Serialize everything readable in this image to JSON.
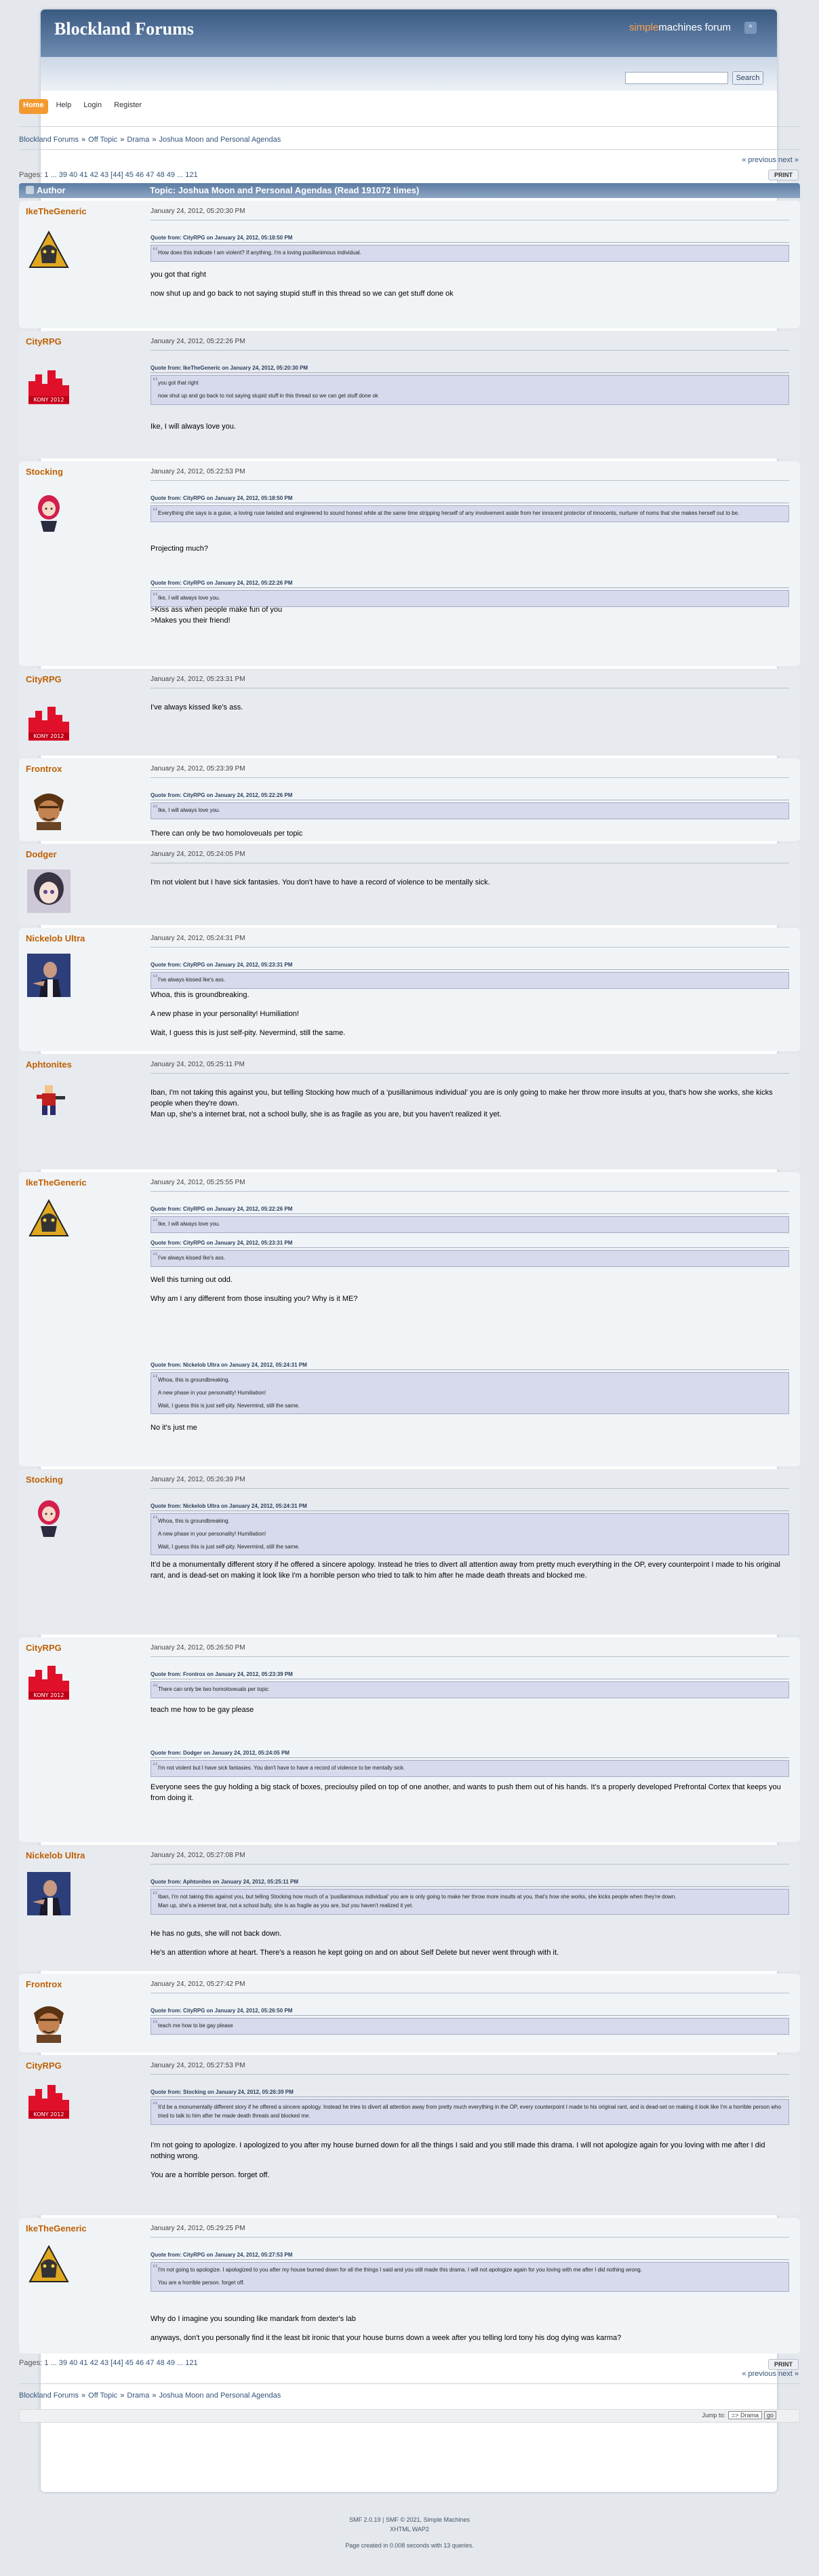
{
  "header": {
    "forum_name": "Blockland Forums",
    "smf_simple": "simple",
    "smf_rest": "machines forum",
    "upshrink": "^"
  },
  "search": {
    "button": "Search"
  },
  "menu": [
    {
      "label": "Home"
    },
    {
      "label": "Help"
    },
    {
      "label": "Login"
    },
    {
      "label": "Register"
    }
  ],
  "breadcrumb": [
    "Blockland Forums",
    "Off Topic",
    "Drama",
    "Joshua Moon and Personal Agendas"
  ],
  "crumb_sep": "»",
  "nav": {
    "prev": "« previous",
    "next": "next »",
    "print": "PRINT",
    "pages_label": "Pages:",
    "pages": "1 ... 39 40 41 42 43 [44] 45 46 47 48 49 ... 121"
  },
  "table_header": {
    "author": "Author",
    "topic": "Topic: Joshua Moon and Personal Agendas  (Read 191072 times)"
  },
  "posts": [
    {
      "user": "IkeTheGeneric",
      "date": "January 24, 2012, 05:20:30 PM",
      "quotes": [
        {
          "h": "Quote from: CityRPG on January 24, 2012, 05:18:50 PM",
          "b": "How does this indicate I am violent? If anything, I'm a loving pusillanimous individual."
        }
      ],
      "text": [
        "you got that right",
        "now shut up and go back to not saying stupid stuff in this thread so we can get stuff done ok"
      ]
    },
    {
      "user": "CityRPG",
      "date": "January 24, 2012, 05:22:26 PM",
      "quotes": [
        {
          "h": "Quote from: IkeTheGeneric on January 24, 2012, 05:20:30 PM",
          "b": "you got that right\n\nnow shut up and go back to not saying stupid stuff in this thread so we can get stuff done ok"
        }
      ],
      "text": [
        "Ike, I will always love you."
      ]
    },
    {
      "user": "Stocking",
      "date": "January 24, 2012, 05:22:53 PM",
      "quotes": [
        {
          "h": "Quote from: CityRPG on January 24, 2012, 05:18:50 PM",
          "b": "Everything she says is a guise, a loving ruse twisted and engineered to sound honest while at the same time stripping herself of any involvement aside from her innocent protector of innocents, nurturer of noms that she makes herself out to be."
        }
      ],
      "text": [
        "Projecting much?"
      ],
      "quotes2": [
        {
          "h": "Quote from: CityRPG on January 24, 2012, 05:22:26 PM",
          "b": "Ike, I will always love you."
        }
      ],
      "text2": [
        ">Kiss ass when people make fun of you\n>Makes you their friend!"
      ]
    },
    {
      "user": "CityRPG",
      "date": "January 24, 2012, 05:23:31 PM",
      "text": [
        "I've always kissed Ike's ass."
      ]
    },
    {
      "user": "Frontrox",
      "date": "January 24, 2012, 05:23:39 PM",
      "quotes": [
        {
          "h": "Quote from: CityRPG on January 24, 2012, 05:22:26 PM",
          "b": "Ike, I will always love you."
        }
      ],
      "text": [
        "There can only be two homoloveuals per topic"
      ]
    },
    {
      "user": "Dodger",
      "date": "January 24, 2012, 05:24:05 PM",
      "text": [
        "I'm not violent but I have sick fantasies. You don't have to have a record of violence to be mentally sick."
      ]
    },
    {
      "user": "Nickelob Ultra",
      "date": "January 24, 2012, 05:24:31 PM",
      "quotes": [
        {
          "h": "Quote from: CityRPG on January 24, 2012, 05:23:31 PM",
          "b": "I've always kissed Ike's ass."
        }
      ],
      "text": [
        "Whoa, this is groundbreaking.",
        "A new phase in your personality!  Humiliation!",
        "Wait, I guess this is just self-pity.  Nevermind, still the same."
      ]
    },
    {
      "user": "Aphtonites",
      "date": "January 24, 2012, 05:25:11 PM",
      "text": [
        "Iban, I'm not taking this against you, but telling Stocking how much of a 'pusillanimous individual' you are is only going to make her throw more insults at you, that's how she works, she kicks people when they're down.\nMan up, she's a internet brat, not a school bully, she is as fragile as you are, but you haven't realized it yet."
      ]
    },
    {
      "user": "IkeTheGeneric",
      "date": "January 24, 2012, 05:25:55 PM",
      "quotes": [
        {
          "h": "Quote from: CityRPG on January 24, 2012, 05:22:26 PM",
          "b": "Ike, I will always love you."
        },
        {
          "h": "Quote from: CityRPG on January 24, 2012, 05:23:31 PM",
          "b": "I've always kissed Ike's ass."
        }
      ],
      "text": [
        "Well this turning out odd.",
        "Why am I any different from those insulting you? Why is it ME?"
      ],
      "quotes2": [
        {
          "h": "Quote from: Nickelob Ultra on January 24, 2012, 05:24:31 PM",
          "b": "Whoa, this is groundbreaking.\n\nA new phase in your personality!  Humiliation!\n\nWait, I guess this is just self-pity.  Nevermind, still the same."
        }
      ],
      "text2": [
        "No it's just me"
      ]
    },
    {
      "user": "Stocking",
      "date": "January 24, 2012, 05:26:39 PM",
      "quotes": [
        {
          "h": "Quote from: Nickelob Ultra on January 24, 2012, 05:24:31 PM",
          "b": "Whoa, this is groundbreaking.\n\nA new phase in your personality!  Humiliation!\n\nWait, I guess this is just self-pity.  Nevermind, still the same."
        }
      ],
      "text": [
        "It'd be a monumentally different story if he offered a sincere apology. Instead he tries to divert all attention away from pretty much everything in the OP, every counterpoint I made to his original rant, and is dead-set on making it look like I'm a horrible person who tried to talk to him after he made death threats and blocked me."
      ]
    },
    {
      "user": "CityRPG",
      "date": "January 24, 2012, 05:26:50 PM",
      "quotes": [
        {
          "h": "Quote from: Frontrox on January 24, 2012, 05:23:39 PM",
          "b": "There can only be two homoloveuals per topic"
        }
      ],
      "text": [
        "teach me how to be gay please"
      ],
      "quotes2": [
        {
          "h": "Quote from: Dodger on January 24, 2012, 05:24:05 PM",
          "b": "I'm not violent but I have sick fantasies. You don't have to have a record of violence to be mentally sick."
        }
      ],
      "text2": [
        "Everyone sees the guy holding a big stack of boxes, precioulsy piled on top of one another, and wants to push them out of his hands. It's a properly developed Prefrontal Cortex that keeps you from doing it."
      ]
    },
    {
      "user": "Nickelob Ultra",
      "date": "January 24, 2012, 05:27:08 PM",
      "quotes": [
        {
          "h": "Quote from: Aphtonites on January 24, 2012, 05:25:11 PM",
          "b": "Iban, I'm not taking this against you, but telling Stocking how much of a 'pusillanimous individual' you are is only going to make her throw more insults at you, that's how she works, she kicks people when they're down.\nMan up, she's a internet brat, not a school bully, she is as fragile as you are, but you haven't realized it yet."
        }
      ],
      "text": [
        "He has no guts, she will not back down.",
        "He's an attention whore at heart.  There's a reason he kept going on and on about Self Delete but never went through with it."
      ]
    },
    {
      "user": "Frontrox",
      "date": "January 24, 2012, 05:27:42 PM",
      "quotes": [
        {
          "h": "Quote from: CityRPG on January 24, 2012, 05:26:50 PM",
          "b": "teach me how to be gay please"
        }
      ],
      "text": []
    },
    {
      "user": "CityRPG",
      "date": "January 24, 2012, 05:27:53 PM",
      "quotes": [
        {
          "h": "Quote from: Stocking on January 24, 2012, 05:26:39 PM",
          "b": "It'd be a monumentally different story if he offered a sincere apology. Instead he tries to divert all attention away from pretty much everything in the OP, every counterpoint I made to his original rant, and is dead-set on making it look like I'm a horrible person who tried to talk to him after he made death threats and blocked me."
        }
      ],
      "text": [
        "I'm not going to apologize. I apologized to you after my house burned down for all the things I said and you still made this drama. I will not apologize again for you loving with me after I did nothing wrong.",
        "You are a horrible person. forget off."
      ]
    },
    {
      "user": "IkeTheGeneric",
      "date": "January 24, 2012, 05:29:25 PM",
      "quotes": [
        {
          "h": "Quote from: CityRPG on January 24, 2012, 05:27:53 PM",
          "b": "I'm not going to apologize. I apologized to you after my house burned down for all the things I said and you still made this drama. I will not apologize again for you loving with me after I did nothing wrong.\n\nYou are a horrible person. forget off."
        }
      ],
      "text": [
        "Why do I imagine you sounding like mandark from dexter's lab",
        "anyways, don't you personally find it the least bit ironic that your house burns down a week after you telling lord tony his dog dying was karma?"
      ]
    }
  ],
  "jump": {
    "label": "Jump to:",
    "selected": "=> Drama",
    "go": "go"
  },
  "footer": {
    "line1": "SMF 2.0.19 | SMF © 2021, Simple Machines",
    "line2": "XHTML    WAP2",
    "line3": "Page created in 0.008 seconds with 13 queries."
  }
}
